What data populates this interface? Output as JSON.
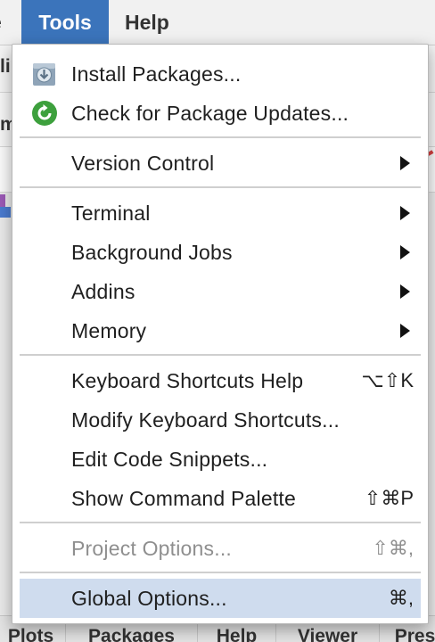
{
  "menubar": {
    "prev_label": "e",
    "tools_label": "Tools",
    "help_label": "Help"
  },
  "background": {
    "frag_1": "li",
    "frag_2": "m"
  },
  "bottom_tabs": [
    "Plots",
    "Packages",
    "Help",
    "Viewer",
    "Pres"
  ],
  "menu": {
    "install_packages": "Install Packages...",
    "check_updates": "Check for Package Updates...",
    "version_control": "Version Control",
    "terminal": "Terminal",
    "background_jobs": "Background Jobs",
    "addins": "Addins",
    "memory": "Memory",
    "keyboard_shortcuts_help": "Keyboard Shortcuts Help",
    "keyboard_shortcuts_help_key": "⌥⇧K",
    "modify_keyboard_shortcuts": "Modify Keyboard Shortcuts...",
    "edit_code_snippets": "Edit Code Snippets...",
    "show_command_palette": "Show Command Palette",
    "show_command_palette_key": "⇧⌘P",
    "project_options": "Project Options...",
    "project_options_key": "⇧⌘,",
    "global_options": "Global Options...",
    "global_options_key": "⌘,"
  },
  "colors": {
    "tools_active": "#3b74bb",
    "selected_row": "#cfdcee",
    "disabled_text": "#8f8f8f",
    "update_icon": "#3da03d"
  },
  "icons": {
    "install": "install-packages-icon",
    "update": "package-update-icon",
    "submenu": "submenu-arrow-icon"
  }
}
